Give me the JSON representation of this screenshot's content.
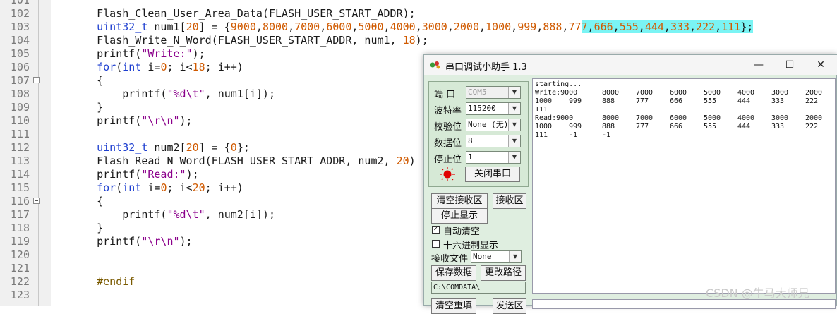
{
  "editor": {
    "lines": [
      {
        "num": "101",
        "code": ""
      },
      {
        "num": "102",
        "code": "    Flash_Clean_User_Area_Data(FLASH_USER_START_ADDR);"
      },
      {
        "num": "103",
        "code_a": "    uint32_t num1[20] = {9000,8000,7000,6000,5000,4000,3000,2000,1000,999,888,77",
        "code_b": "7,666,555,444,333,222,111};"
      },
      {
        "num": "104",
        "code": "    Flash_Write_N_Word(FLASH_USER_START_ADDR, num1, 18);"
      },
      {
        "num": "105",
        "code": "    printf(\"Write:\");"
      },
      {
        "num": "106",
        "code": "    for(int i=0; i<18; i++)"
      },
      {
        "num": "107",
        "code": "    {"
      },
      {
        "num": "108",
        "code": "        printf(\"%d\\t\", num1[i]);"
      },
      {
        "num": "109",
        "code": "    }"
      },
      {
        "num": "110",
        "code": "    printf(\"\\r\\n\");"
      },
      {
        "num": "111",
        "code": ""
      },
      {
        "num": "112",
        "code": "    uint32_t num2[20] = {0};"
      },
      {
        "num": "113",
        "code": "    Flash_Read_N_Word(FLASH_USER_START_ADDR, num2, 20)"
      },
      {
        "num": "114",
        "code": "    printf(\"Read:\");"
      },
      {
        "num": "115",
        "code": "    for(int i=0; i<20; i++)"
      },
      {
        "num": "116",
        "code": "    {"
      },
      {
        "num": "117",
        "code": "        printf(\"%d\\t\", num2[i]);"
      },
      {
        "num": "118",
        "code": "    }"
      },
      {
        "num": "119",
        "code": "    printf(\"\\r\\n\");"
      },
      {
        "num": "120",
        "code": ""
      },
      {
        "num": "121",
        "code": ""
      },
      {
        "num": "122",
        "code": "    #endif"
      },
      {
        "num": "123",
        "code": ""
      }
    ]
  },
  "serial": {
    "title": "串口调试小助手 1.3",
    "minimize": "—",
    "maximize": "☐",
    "close": "✕",
    "port_label": "端 口",
    "port_value": "COM5",
    "baud_label": "波特率",
    "baud_value": "115200",
    "parity_label": "校验位",
    "parity_value": "None (无)",
    "databits_label": "数据位",
    "databits_value": "8",
    "stopbits_label": "停止位",
    "stopbits_value": "1",
    "close_port_button": "关闭串口",
    "clear_recv_button": "清空接收区",
    "recv_area_label": "接收区",
    "stop_display_button": "停止显示",
    "auto_clear_label": "自动清空",
    "auto_clear_checked": "✓",
    "hex_display_label": "十六进制显示",
    "recv_file_label": "接收文件",
    "recv_file_value": "None",
    "save_data_button": "保存数据",
    "change_path_button": "更改路径",
    "path_value": "C:\\COMDATA\\",
    "clear_resend_button": "清空重填",
    "send_area_label": "发送区",
    "recv_lines": [
      {
        "head": "starting...",
        "cells": []
      },
      {
        "head": "Write:9000",
        "cells": [
          "8000",
          "7000",
          "6000",
          "5000",
          "4000",
          "3000",
          "2000"
        ]
      },
      {
        "head": "1000",
        "cells": [
          "999",
          "888",
          "777",
          "666",
          "555",
          "444",
          "333",
          "222"
        ]
      },
      {
        "head": "111",
        "cells": []
      },
      {
        "head": "Read:9000",
        "cells": [
          "8000",
          "7000",
          "6000",
          "5000",
          "4000",
          "3000",
          "2000"
        ]
      },
      {
        "head": "1000",
        "cells": [
          "999",
          "888",
          "777",
          "666",
          "555",
          "444",
          "333",
          "222"
        ]
      },
      {
        "head": "111",
        "cells": [
          "-1",
          "-1"
        ]
      }
    ]
  },
  "watermark": "CSDN @牛马大师兄",
  "colors": {
    "highlight": "#7af4f4",
    "keyword": "#1e3fd0",
    "string": "#8b008b",
    "number": "#d05a00",
    "led": "#e00000"
  }
}
